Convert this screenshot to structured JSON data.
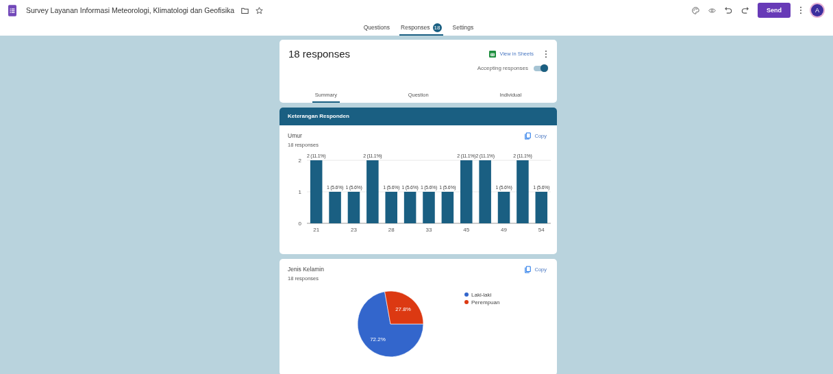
{
  "header": {
    "title": "Survey Layanan Informasi Meteorologi, Klimatologi dan Geofisika",
    "send": "Send",
    "avatar": "A"
  },
  "form_tabs": [
    {
      "label": "Questions",
      "selected": false
    },
    {
      "label": "Responses",
      "badge": "18",
      "selected": true
    },
    {
      "label": "Settings",
      "selected": false
    }
  ],
  "responses_card": {
    "title": "18 responses",
    "view_in_sheets": "View in Sheets",
    "accepting_label": "Accepting responses",
    "accepting": true,
    "tabs": [
      {
        "label": "Summary",
        "selected": true
      },
      {
        "label": "Question",
        "selected": false
      },
      {
        "label": "Individual",
        "selected": false
      }
    ]
  },
  "section": {
    "title": "Keterangan Responden"
  },
  "questions": [
    {
      "title": "Umur",
      "count": "18 responses",
      "copy": "Copy",
      "chart_data": {
        "type": "bar",
        "categories": [
          "21",
          null,
          "23",
          null,
          "28",
          null,
          "33",
          null,
          "45",
          null,
          "49",
          null,
          "54"
        ],
        "values": [
          2,
          1,
          1,
          2,
          1,
          1,
          1,
          1,
          2,
          2,
          1,
          2,
          1
        ],
        "value_labels": [
          "2 (11.1%)",
          "1 (5.6%)",
          "1 (5.6%)",
          "2 (11.1%)",
          "1 (5.6%)",
          "1 (5.6%)",
          "1 (5.6%)",
          "1 (5.6%)",
          "2 (11.1%)",
          "2 (11.1%)",
          "1 (5.6%)",
          "2 (11.1%)",
          "1 (5.6%)"
        ],
        "yticks": [
          0,
          1,
          2
        ],
        "ylim": [
          0,
          2
        ]
      }
    },
    {
      "title": "Jenis Kelamin",
      "count": "18 responses",
      "copy": "Copy",
      "chart_data": {
        "type": "pie",
        "categories": [
          "Laki-laki",
          "Perempuan"
        ],
        "values": [
          72.2,
          27.8
        ],
        "legend": "right",
        "colors": [
          "#3366cc",
          "#dc3912"
        ],
        "value_labels": [
          "72.2%",
          "27.8%"
        ]
      }
    }
  ]
}
